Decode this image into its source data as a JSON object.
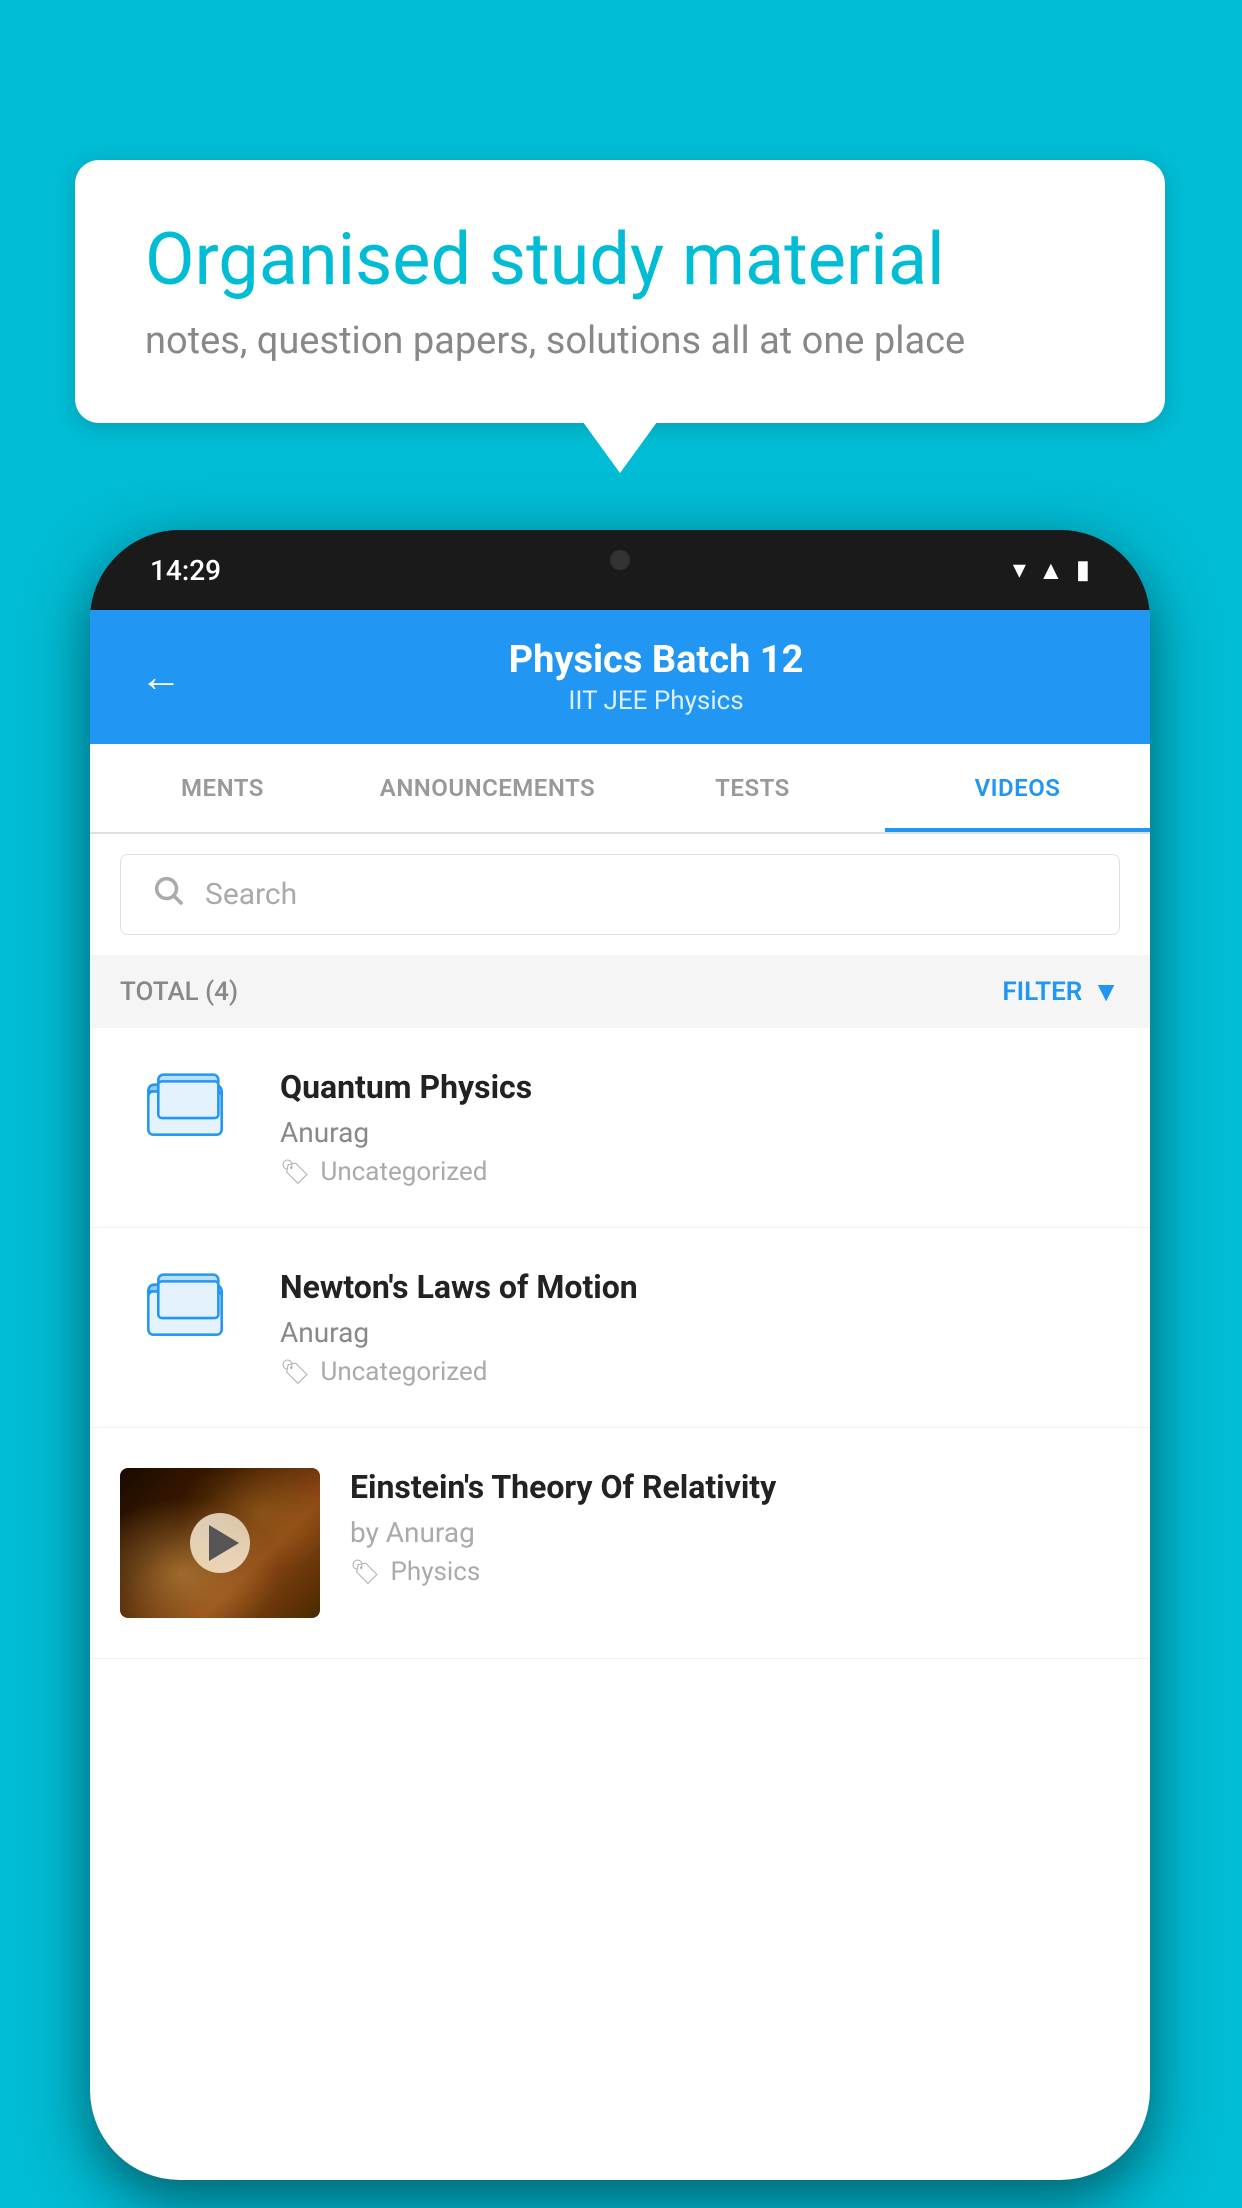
{
  "background_color": "#00BCD4",
  "speech_bubble": {
    "title": "Organised study material",
    "subtitle": "notes, question papers, solutions all at one place"
  },
  "phone": {
    "status_bar": {
      "time": "14:29"
    },
    "header": {
      "title": "Physics Batch 12",
      "subtitle": "IIT JEE   Physics",
      "back_label": "←"
    },
    "tabs": [
      {
        "label": "MENTS",
        "active": false
      },
      {
        "label": "ANNOUNCEMENTS",
        "active": false
      },
      {
        "label": "TESTS",
        "active": false
      },
      {
        "label": "VIDEOS",
        "active": true
      }
    ],
    "search": {
      "placeholder": "Search"
    },
    "filter_row": {
      "total_label": "TOTAL (4)",
      "filter_label": "FILTER"
    },
    "videos": [
      {
        "id": "quantum",
        "title": "Quantum Physics",
        "author": "Anurag",
        "tag": "Uncategorized",
        "has_thumbnail": false
      },
      {
        "id": "newton",
        "title": "Newton's Laws of Motion",
        "author": "Anurag",
        "tag": "Uncategorized",
        "has_thumbnail": false
      },
      {
        "id": "einstein",
        "title": "Einstein's Theory Of Relativity",
        "author": "by Anurag",
        "tag": "Physics",
        "has_thumbnail": true
      }
    ]
  }
}
